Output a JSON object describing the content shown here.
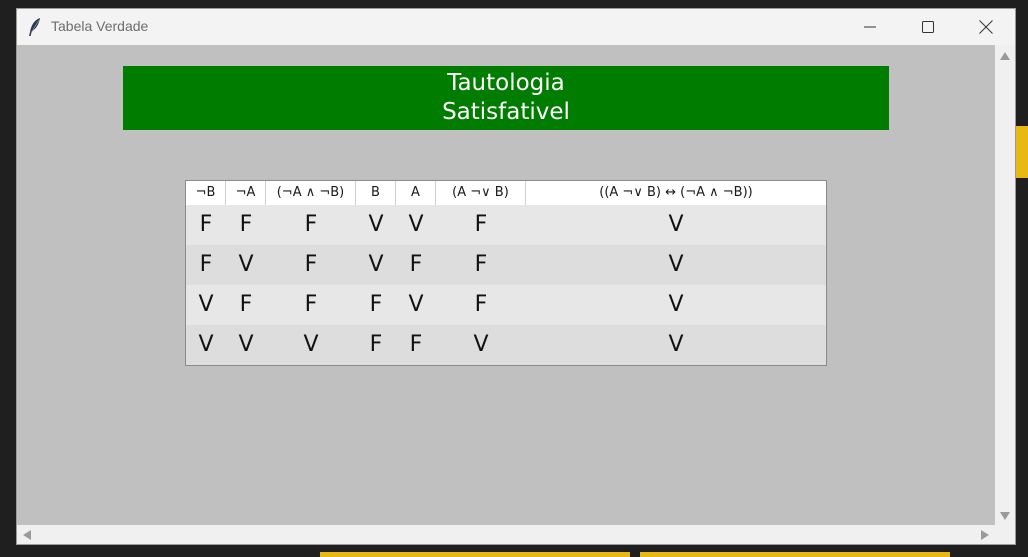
{
  "window": {
    "title": "Tabela Verdade"
  },
  "banner": {
    "line1": "Tautologia",
    "line2": "Satisfativel"
  },
  "table": {
    "headers": [
      "¬B",
      "¬A",
      "(¬A ∧ ¬B)",
      "B",
      "A",
      "(A ¬∨ B)",
      "((A ¬∨ B) ↔ (¬A ∧ ¬B))"
    ],
    "rows": [
      [
        "F",
        "F",
        "F",
        "V",
        "V",
        "F",
        "V"
      ],
      [
        "F",
        "V",
        "F",
        "V",
        "F",
        "F",
        "V"
      ],
      [
        "V",
        "F",
        "F",
        "F",
        "V",
        "F",
        "V"
      ],
      [
        "V",
        "V",
        "V",
        "F",
        "F",
        "V",
        "V"
      ]
    ]
  },
  "icons": {
    "app": "feather-icon",
    "minimize": "minimize-icon",
    "maximize": "maximize-icon",
    "close": "close-icon"
  },
  "colors": {
    "banner": "#007c00",
    "canvas": "#c0c0c0"
  }
}
